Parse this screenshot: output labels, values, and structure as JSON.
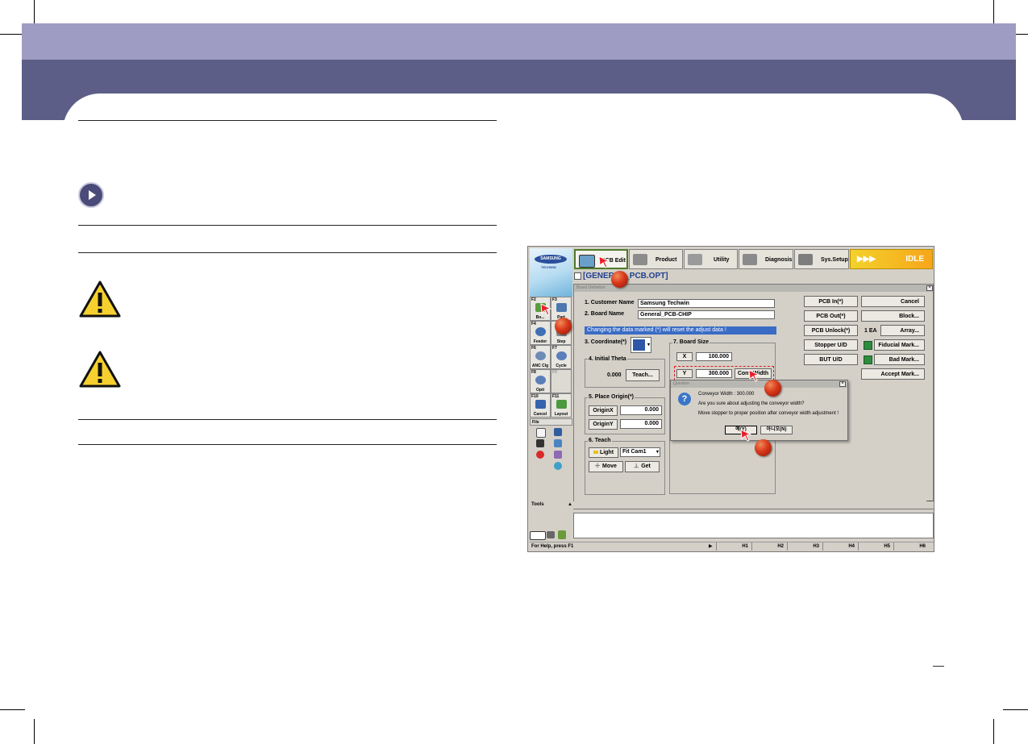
{
  "app": {
    "logo_text": "SAMSUNG",
    "logo_sub": "TECHWIN",
    "tabs": [
      {
        "label": "PCB Edit",
        "icon": "pcb-edit-icon",
        "active": true
      },
      {
        "label": "Product",
        "icon": "product-icon"
      },
      {
        "label": "Utility",
        "icon": "utility-icon"
      },
      {
        "label": "Diagnosis",
        "icon": "diagnosis-icon"
      },
      {
        "label": "Sys.Setup",
        "icon": "sys-setup-icon"
      }
    ],
    "status": {
      "arrows": "▶▶▶",
      "label": "IDLE"
    },
    "file_name": "[GENERAL_PCB.OPT]",
    "sidebar": {
      "buttons": [
        {
          "key": "F2",
          "label": "Bo..."
        },
        {
          "key": "F3",
          "label": "Part"
        },
        {
          "key": "F4",
          "label": "Feeder"
        },
        {
          "key": "",
          "label": "Step"
        },
        {
          "key": "F6",
          "label": "ANC Clg"
        },
        {
          "key": "F7",
          "label": "Cycle"
        },
        {
          "key": "F8",
          "label": "Opti"
        },
        {
          "key": "F9",
          "label": ""
        },
        {
          "key": "F10",
          "label": "Cancel"
        },
        {
          "key": "F11",
          "label": "Layout"
        }
      ],
      "file_header": "File",
      "tools_header": "Tools"
    },
    "dialog": {
      "title": "Board Definition",
      "customer_label": "1. Customer Name",
      "customer_value": "Samsung Techwin",
      "board_label": "2. Board Name",
      "board_value": "General_PCB-CHIP",
      "warning": "Changing the data marked (*) will reset the adjust data !",
      "coordinate_label": "3. Coordinate(*)",
      "theta_label": "4. Initial Theta",
      "theta_value": "0.000",
      "teach_button": "Teach...",
      "origin_label": "5. Place Origin(*)",
      "origin_x_label": "OriginX",
      "origin_x_value": "0.000",
      "origin_y_label": "OriginY",
      "origin_y_value": "0.000",
      "teach_label": "6. Teach",
      "light_button": "Light",
      "camera_value": "Fit Cam1",
      "move_button": "Move",
      "get_button": "Get",
      "board_size_label": "7. Board Size",
      "x_label": "X",
      "x_value": "100.000",
      "y_label": "Y",
      "y_value": "300.000",
      "conv_width_button": "Conv.Width",
      "right_buttons": [
        "PCB In(*)",
        "PCB Out(*)",
        "PCB Unlock(*)",
        "Stopper U/D",
        "BUT U/D"
      ],
      "action_buttons": [
        "Cancel",
        "Block...",
        "Array...",
        "Fiducial Mark...",
        "Bad Mark...",
        "Accept Mark..."
      ],
      "array_count": "1 EA"
    },
    "message": {
      "title": "Question",
      "line1": "Conveyor Width : 300.000",
      "line2": "Are you sure about adjusting the conveyor width?",
      "line3": "Move stopper to proper position after conveyor width adjustment !",
      "yes_button": "예(Y)",
      "no_button": "아니오(N)"
    },
    "statusbar": {
      "help": "For Help, press F1",
      "h_buttons": [
        "H1",
        "H2",
        "H3",
        "H4",
        "H5",
        "H6"
      ]
    }
  },
  "colors": {
    "accent_band": "#5d5e87",
    "light_band": "#9e9cc2",
    "marker": "#d8381a",
    "idle": "#f5b51f"
  }
}
